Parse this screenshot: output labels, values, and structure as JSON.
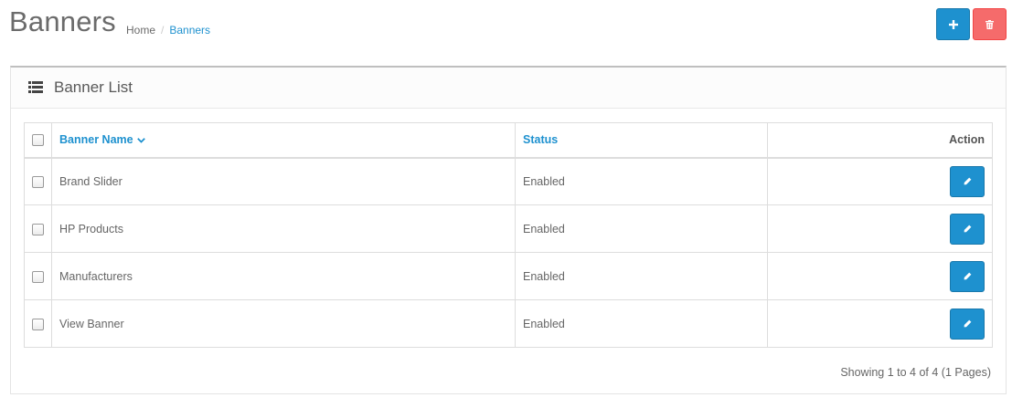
{
  "header": {
    "title": "Banners",
    "breadcrumb": {
      "home": "Home",
      "separator": "/",
      "current": "Banners"
    },
    "add_icon": "plus-icon",
    "delete_icon": "trash-icon"
  },
  "panel": {
    "title": "Banner List",
    "icon": "list-icon"
  },
  "table": {
    "columns": {
      "name": "Banner Name",
      "status": "Status",
      "action": "Action"
    },
    "sort_icon": "chevron-down-icon",
    "rows": [
      {
        "name": "Brand Slider",
        "status": "Enabled"
      },
      {
        "name": "HP Products",
        "status": "Enabled"
      },
      {
        "name": "Manufacturers",
        "status": "Enabled"
      },
      {
        "name": "View Banner",
        "status": "Enabled"
      }
    ],
    "edit_icon": "pencil-icon"
  },
  "pagination": {
    "summary": "Showing 1 to 4 of 4 (1 Pages)"
  },
  "colors": {
    "primary": "#1e91cf",
    "danger": "#f56b6b"
  }
}
